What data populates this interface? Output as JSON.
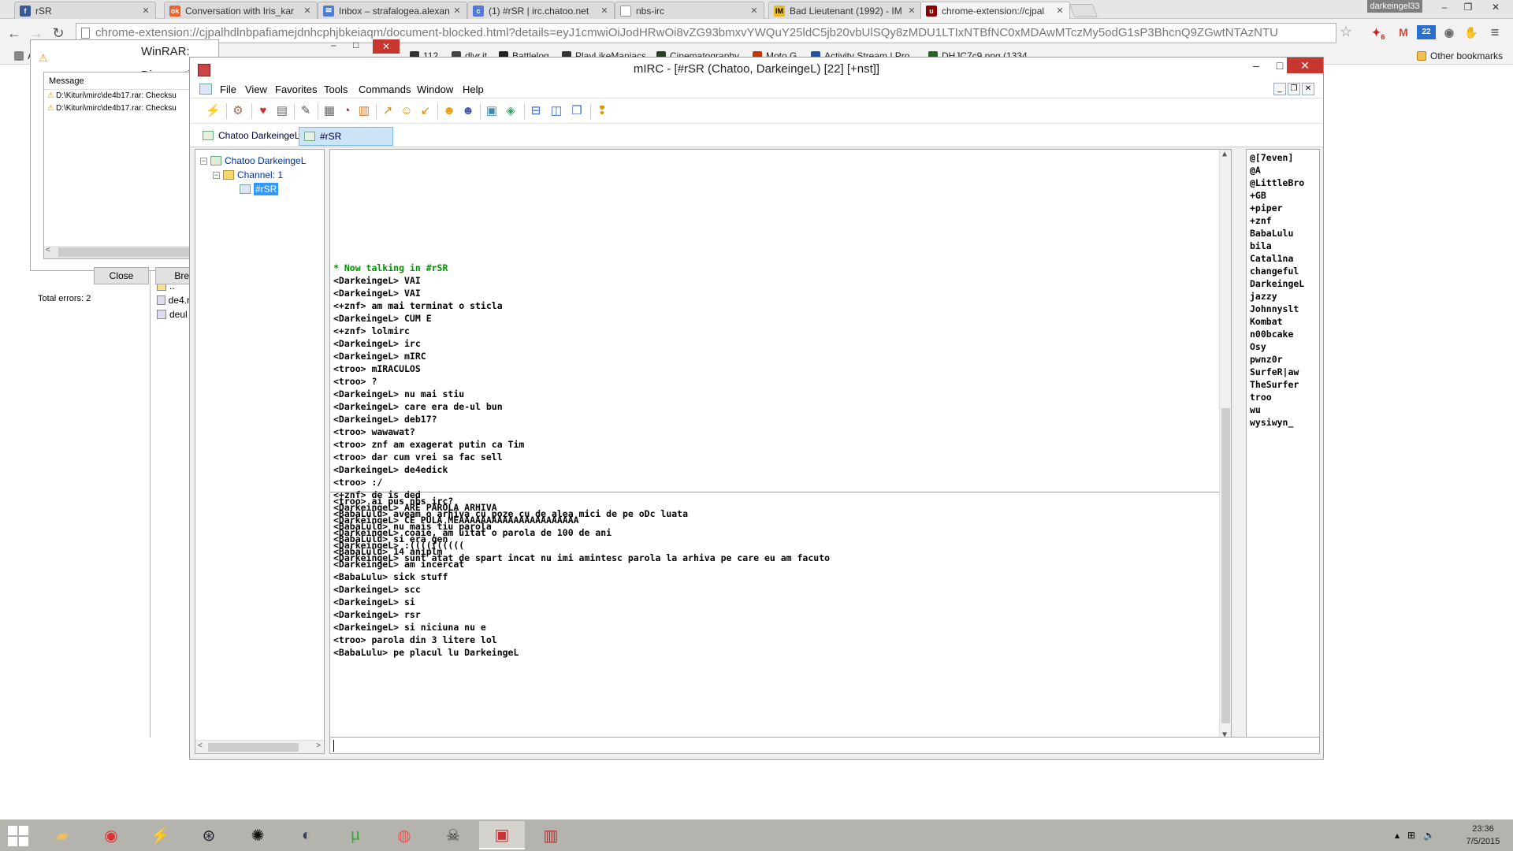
{
  "browser": {
    "tabs": [
      {
        "label": "rSR",
        "icon": "facebook-icon",
        "color": "#3b5998"
      },
      {
        "label": "Conversation with Iris_kar",
        "icon": "ok-icon",
        "color": "#e8632d"
      },
      {
        "label": "Inbox – strafalogea.alexan",
        "icon": "mail-icon",
        "color": "#4a7fd4"
      },
      {
        "label": "(1) #rSR | irc.chatoo.net",
        "icon": "chatoo-icon",
        "color": "#5577dd"
      },
      {
        "label": "nbs-irc",
        "icon": "page-icon",
        "color": "#ffffff"
      },
      {
        "label": "Bad Lieutenant (1992) - IM",
        "icon": "imdb-icon",
        "color": "#e6b91e"
      },
      {
        "label": "chrome-extension://cjpal",
        "icon": "ublock-icon",
        "color": "#8b0000"
      }
    ],
    "profile_name": "darkeingel33",
    "url": "chrome-extension://cjpalhdlnbpafiamejdnhcphjbkeiaqm/document-blocked.html?details=eyJ1cmwiOiJodHRwOi8vZG93bmxvYWQuY25ldC5jb20vbUlSQy8zMDU1LTIxNTBfNC0xMDAwMTczMy5odG1sP3BhcnQ9ZGwtNTAzNTU",
    "extensions": [
      {
        "name": "lastpass-icon",
        "text": "6",
        "color": "#cc2222"
      },
      {
        "name": "gmail-icon",
        "text": "M",
        "color": "#d14836"
      },
      {
        "name": "feed-icon",
        "text": "22",
        "color": "#2a6fcf"
      },
      {
        "name": "shield-icon",
        "text": "◉",
        "color": "#666666"
      },
      {
        "name": "hand-icon",
        "text": "✋",
        "color": "#444444"
      },
      {
        "name": "menu-icon",
        "text": "≡",
        "color": "#444444"
      }
    ],
    "bookmarks": [
      {
        "label": "Ap",
        "color": "#888888"
      },
      {
        "label": "112",
        "color": "#333333"
      },
      {
        "label": "dlvr.it",
        "color": "#444444"
      },
      {
        "label": "Battlelog",
        "color": "#222222"
      },
      {
        "label": "PlayLikeManiacs",
        "color": "#333333"
      },
      {
        "label": "Cinematography",
        "color": "#224422"
      },
      {
        "label": "Moto G",
        "color": "#cc3300"
      },
      {
        "label": "Activity Stream | Pro...",
        "color": "#2255aa"
      },
      {
        "label": "DHJC7c9.png (1334...",
        "color": "#226622"
      }
    ],
    "other_bookmarks": "Other bookmarks"
  },
  "winrar": {
    "title": "WinRAR: Diagnostic messages",
    "list_header": "Message",
    "messages": [
      "D:\\Kituri\\mirc\\de4b17.rar: Checksu",
      "D:\\Kituri\\mirc\\de4b17.rar: Checksu"
    ],
    "close_label": "Close",
    "break_label": "Break",
    "total_errors": "Total errors: 2"
  },
  "explorer": {
    "items": [
      "..",
      "de4.r",
      "deul"
    ]
  },
  "mirc": {
    "title": "mIRC - [#rSR (Chatoo, DarkeingeL) [22] [+nst]]",
    "menu": [
      "File",
      "View",
      "Favorites",
      "Tools",
      "Commands",
      "Window",
      "Help"
    ],
    "switchbar": [
      "Chatoo DarkeingeL",
      "#rSR"
    ],
    "tree": {
      "server": "Chatoo DarkeingeL",
      "folder": "Channel: 1",
      "channel": "#rSR"
    },
    "chat_top": [
      {
        "text": "* Now talking in #rSR",
        "sys": true
      },
      {
        "text": "<DarkeingeL> VAI"
      },
      {
        "text": "<DarkeingeL> VAI"
      },
      {
        "text": "<+znf> am mai terminat o sticla"
      },
      {
        "text": "<DarkeingeL> CUM E"
      },
      {
        "text": "<+znf> lolmirc"
      },
      {
        "text": "<DarkeingeL> irc"
      },
      {
        "text": "<DarkeingeL> mIRC"
      },
      {
        "text": "<troo> mIRACULOS"
      },
      {
        "text": "<troo> ?"
      },
      {
        "text": "<DarkeingeL> nu mai stiu"
      },
      {
        "text": "<DarkeingeL> care era de-ul bun"
      },
      {
        "text": "<DarkeingeL> deb17?"
      },
      {
        "text": "<troo> wawawat?"
      },
      {
        "text": "<troo> znf am exagerat putin ca Tim"
      },
      {
        "text": "<troo> dar cum vrei sa fac sell"
      },
      {
        "text": "<DarkeingeL> de4edick"
      },
      {
        "text": "<troo> :/"
      },
      {
        "text": "<+znf> de is ded"
      },
      {
        "text": "<DarkeingeL> ARE PAROLA ARHIVA"
      },
      {
        "text": "<DarkeingeL> CE PULA MEAAAAAAAAAAAAAAAAAAAAAA"
      },
      {
        "text": "<DarkeingeL> coaie, am uitat o parola de 100 de ani"
      },
      {
        "text": "<DarkeingeL> :(((((((((("
      },
      {
        "text": "<DarkeingeL> sunt atat de spart incat nu imi amintesc parola la arhiva pe care eu am facuto"
      }
    ],
    "chat_bottom": [
      {
        "text": "<troo> ai pus nbs irc?"
      },
      {
        "text": "<BabaLulu> aveam o arhiva cu poze cu de alea mici de pe oDc luata"
      },
      {
        "text": "<BabaLulu> nu mais tiu parola"
      },
      {
        "text": "<BabaLulu> si era gen"
      },
      {
        "text": "<BabaLulu> 14 aniplm"
      },
      {
        "text": "<DarkeingeL> am incercat"
      },
      {
        "text": "<BabaLulu> sick stuff"
      },
      {
        "text": "<DarkeingeL> scc"
      },
      {
        "text": "<DarkeingeL> si"
      },
      {
        "text": "<DarkeingeL> rsr"
      },
      {
        "text": "<DarkeingeL> si niciuna nu e"
      },
      {
        "text": "<troo> parola din 3 litere lol"
      },
      {
        "text": "<BabaLulu> pe placul lu DarkeingeL"
      }
    ],
    "nicklist": [
      "@[7even]",
      "@A",
      "@LittleBro",
      "+GB",
      "+piper",
      "+znf",
      "BabaLulu",
      "bila",
      "Catal1na",
      "changeful",
      "DarkeingeL",
      "jazzy",
      "Johnnyslt",
      "Kombat",
      "n00bcake",
      "Osy",
      "pwnz0r",
      "SurfeR|aw",
      "TheSurfer",
      "troo",
      "wu",
      "wysiwyn_"
    ],
    "input_value": ""
  },
  "taskbar": {
    "apps": [
      "file-explorer-icon",
      "chrome-icon",
      "winamp-icon",
      "steam-icon",
      "spider-icon",
      "skype-icon",
      "utorrent-icon",
      "firefox-icon",
      "alien-icon",
      "mirc-icon",
      "winrar-icon"
    ],
    "clock_time": "23:36",
    "clock_date": "7/5/2015"
  }
}
